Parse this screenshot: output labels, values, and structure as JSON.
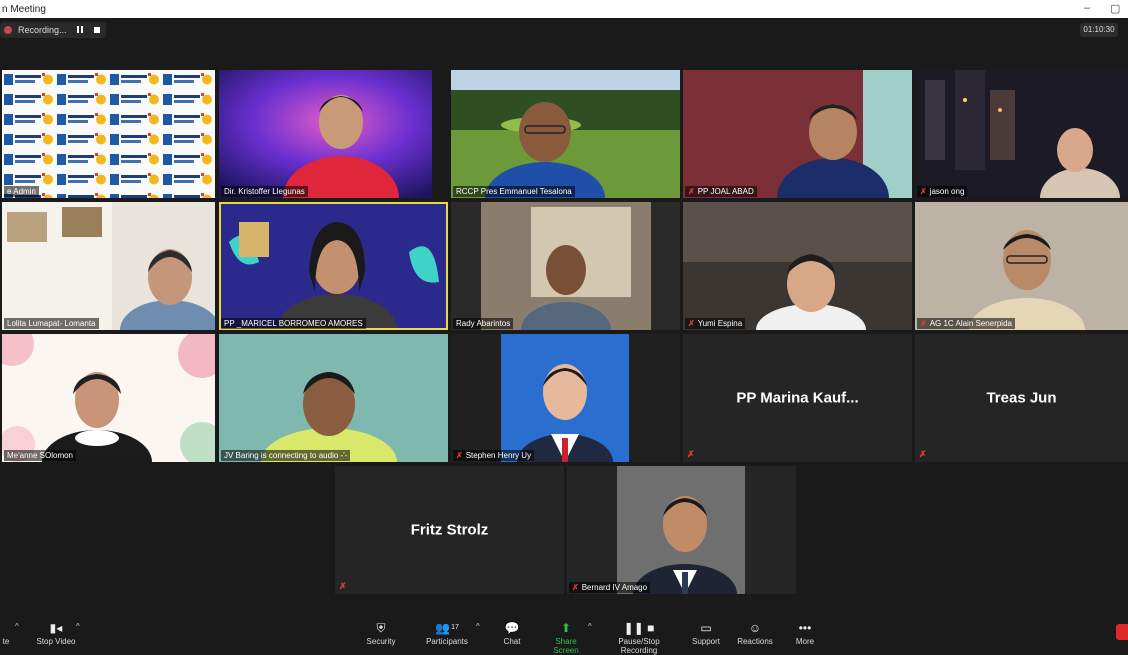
{
  "window": {
    "title": "n Meeting",
    "minimize": "–",
    "restore": "▢"
  },
  "recording": {
    "label": "Recording..."
  },
  "timer": "01:10:30",
  "colors": {
    "mute": "#e53935",
    "active_speaker": "#e8d94a",
    "share": "#31c24e",
    "end": "#e02828"
  },
  "participants": [
    {
      "name": "RC Admin",
      "display": "e Admin",
      "muted": false,
      "video": "rotary-banner"
    },
    {
      "name": "Dir. Kristoffer Llegunas",
      "muted": false,
      "video": "camera"
    },
    {
      "name": "RCCP Pres Emmanuel Tesalona",
      "muted": false,
      "video": "camera"
    },
    {
      "name": "PP JOAL ABAD",
      "muted": true,
      "video": "camera"
    },
    {
      "name": "jason ong",
      "muted": true,
      "video": "camera"
    },
    {
      "name": "Lolita Lumapat- Lomanta",
      "muted": false,
      "video": "camera"
    },
    {
      "name": "PP _MARICEL BORROMEO AMORES",
      "muted": false,
      "video": "camera",
      "active": true
    },
    {
      "name": "Rady Abarintos",
      "muted": false,
      "video": "camera"
    },
    {
      "name": "Yumi Espina",
      "muted": true,
      "video": "camera"
    },
    {
      "name": "AG 1C Alain Senerpida",
      "muted": true,
      "video": "camera"
    },
    {
      "name": "Me'anne SOlomon",
      "muted": false,
      "video": "camera"
    },
    {
      "name": "JV Baring is connecting to audio -'-",
      "muted": false,
      "video": "camera"
    },
    {
      "name": "Stephen Henry Uy",
      "muted": true,
      "video": "camera"
    },
    {
      "name": "PP Marina Kauf...",
      "muted": true,
      "video": "off"
    },
    {
      "name": "Treas Jun",
      "muted": true,
      "video": "off"
    },
    {
      "name": "Fritz Strolz",
      "muted": true,
      "video": "off"
    },
    {
      "name": "Bernard IV Amago",
      "muted": true,
      "video": "camera"
    }
  ],
  "toolbar": {
    "audio": "te",
    "stop_video": "Stop Video",
    "security": "Security",
    "participants": "Participants",
    "participants_count": "17",
    "chat": "Chat",
    "share_screen": "Share Screen",
    "pause_recording": "Pause/Stop Recording",
    "support": "Support",
    "reactions": "Reactions",
    "more": "More"
  }
}
